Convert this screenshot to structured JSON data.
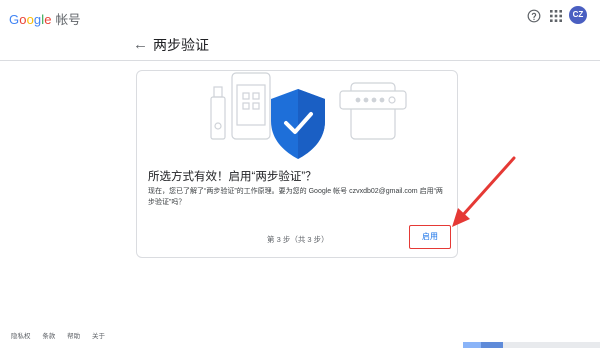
{
  "header": {
    "logo_text": "Google",
    "product": "帐号",
    "avatar_initials": "CZ",
    "logo_colors": [
      "#4285F4",
      "#EA4335",
      "#FBBC05",
      "#4285F4",
      "#34A853",
      "#EA4335"
    ]
  },
  "page": {
    "title": "两步验证"
  },
  "card": {
    "title": "所选方式有效！启用“两步验证”？",
    "body": "现在，您已了解了“两步验证”的工作原理。要为您的 Google 帐号 czvxdb02@gmail.com 启用“两步验证”吗？",
    "step": "第 3 步（共 3 步）",
    "enable_label": "启用"
  },
  "footer": {
    "links": [
      "隐私权",
      "条款",
      "帮助",
      "关于"
    ]
  },
  "colors": {
    "accent": "#1a73e8",
    "shield": "#1e6fd9",
    "annotation": "#e53935"
  }
}
